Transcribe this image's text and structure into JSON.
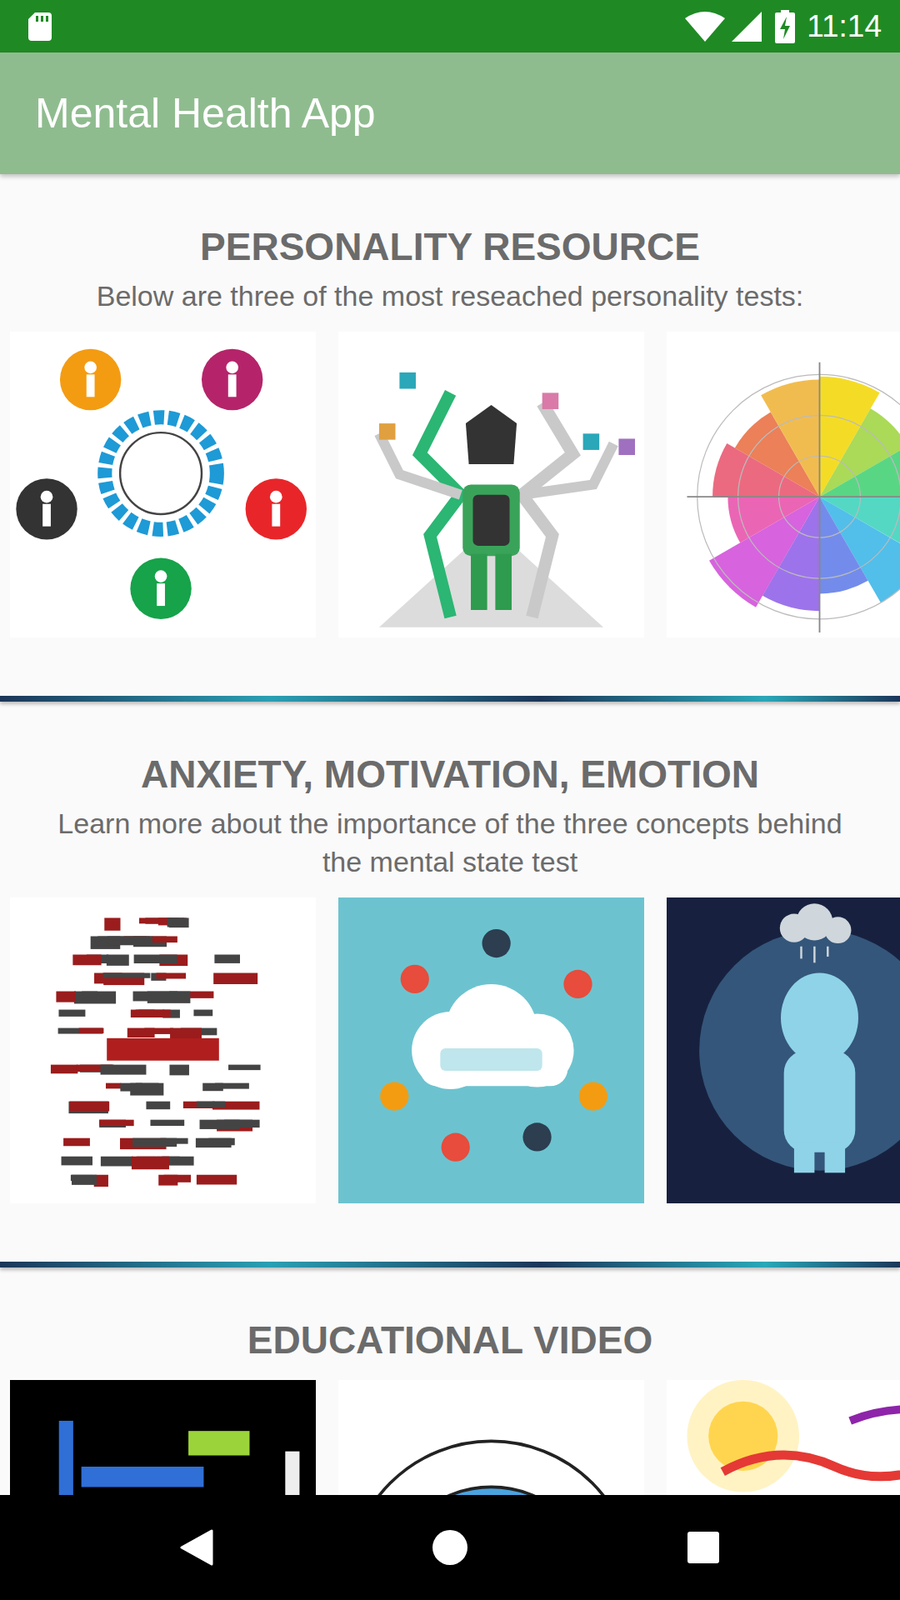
{
  "status_bar": {
    "time": "11:14"
  },
  "app_bar": {
    "title": "Mental Health App"
  },
  "sections": [
    {
      "title": "PERSONALITY RESOURCE",
      "subtitle": "Below are three of the most reseached personality tests:",
      "images": [
        {
          "kind": "bigfive"
        },
        {
          "kind": "maze"
        },
        {
          "kind": "wheel"
        }
      ]
    },
    {
      "title": "ANXIETY, MOTIVATION, EMOTION",
      "subtitle": "Learn more about the importance of the three concepts behind the mental state test",
      "images": [
        {
          "kind": "wordhead"
        },
        {
          "kind": "motivation"
        },
        {
          "kind": "neuroticism"
        }
      ]
    },
    {
      "title": "EDUCATIONAL VIDEO",
      "images": [
        {
          "kind": "darkwords"
        },
        {
          "kind": "growth"
        },
        {
          "kind": "mindful"
        }
      ]
    }
  ]
}
